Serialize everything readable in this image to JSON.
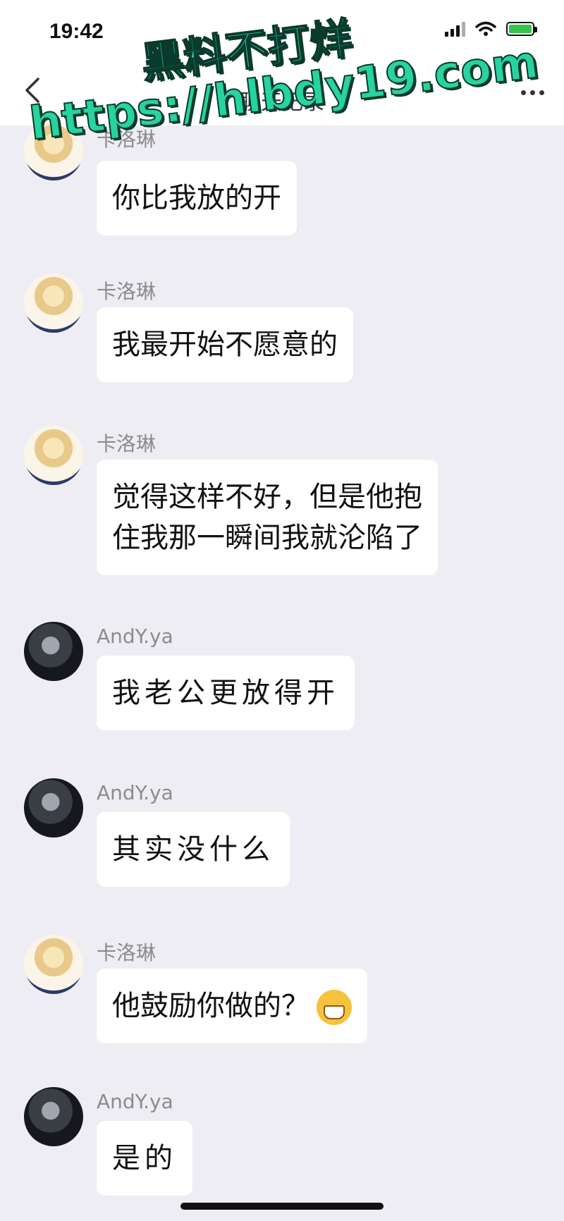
{
  "status_bar": {
    "time": "19:42"
  },
  "nav": {
    "title": "聊天记录",
    "back_icon": "chevron-left-icon",
    "more_icon": "ellipsis-icon"
  },
  "watermark": {
    "line1": "黑料不打烊",
    "line2": "https://hlbdy19.com"
  },
  "messages": [
    {
      "sender": "卡洛琳",
      "text": "你比我放的开",
      "avatar": "anime-girl-avatar"
    },
    {
      "sender": "卡洛琳",
      "text": "我最开始不愿意的",
      "avatar": "anime-girl-avatar"
    },
    {
      "sender": "卡洛琳",
      "line1": "觉得这样不好，但是他抱",
      "line2": "住我那一瞬间我就沦陷了",
      "avatar": "anime-girl-avatar"
    },
    {
      "sender": "AndY.ya",
      "text": "我老公更放得开",
      "avatar": "city-night-avatar"
    },
    {
      "sender": "AndY.ya",
      "text": "其实没什么",
      "avatar": "city-night-avatar"
    },
    {
      "sender": "卡洛琳",
      "text": "他鼓励你做的？",
      "emoji": "grinning-face-icon",
      "avatar": "anime-girl-avatar"
    },
    {
      "sender": "AndY.ya",
      "text": "是的",
      "avatar": "city-night-avatar"
    }
  ],
  "colors": {
    "background": "#ededf3",
    "bubble": "#ffffff",
    "watermark": "#27d39e"
  }
}
